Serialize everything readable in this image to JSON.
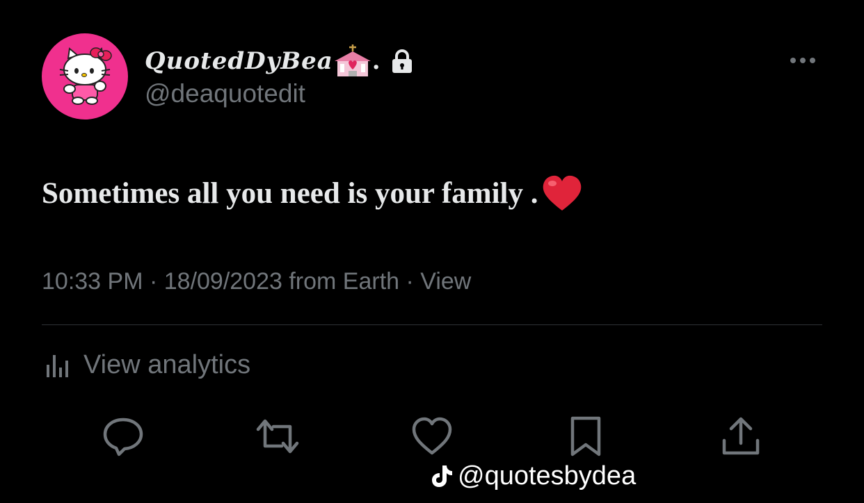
{
  "author": {
    "display_name": "QuotedDyBea",
    "display_name_suffix": ".",
    "handle": "@deaquotedit",
    "avatar_icon": "hello-kitty-avatar",
    "name_emoji_icon": "wedding-chapel-emoji",
    "protected_icon": "lock-icon"
  },
  "tweet": {
    "text": "Sometimes all you need is your family .",
    "emoji_icon": "red-heart-emoji"
  },
  "meta": {
    "time": "10:33 PM",
    "date": "18/09/2023",
    "source": "from Earth",
    "views_label": "View",
    "text": "10:33 PM · 18/09/2023 from Earth · View"
  },
  "analytics": {
    "label": "View analytics",
    "icon": "analytics-bars-icon"
  },
  "actions": [
    {
      "name": "reply",
      "icon": "reply-icon"
    },
    {
      "name": "retweet",
      "icon": "retweet-icon"
    },
    {
      "name": "like",
      "icon": "heart-icon"
    },
    {
      "name": "bookmark",
      "icon": "bookmark-icon"
    },
    {
      "name": "share",
      "icon": "share-icon"
    }
  ],
  "watermark": {
    "text": "@quotesbydea",
    "icon": "tiktok-icon"
  },
  "colors": {
    "background": "#000000",
    "primary_text": "#e7e9ea",
    "secondary_text": "#71767b",
    "divider": "#2f3336",
    "avatar_background": "#f0308e",
    "heart_red": "#e0243a"
  }
}
